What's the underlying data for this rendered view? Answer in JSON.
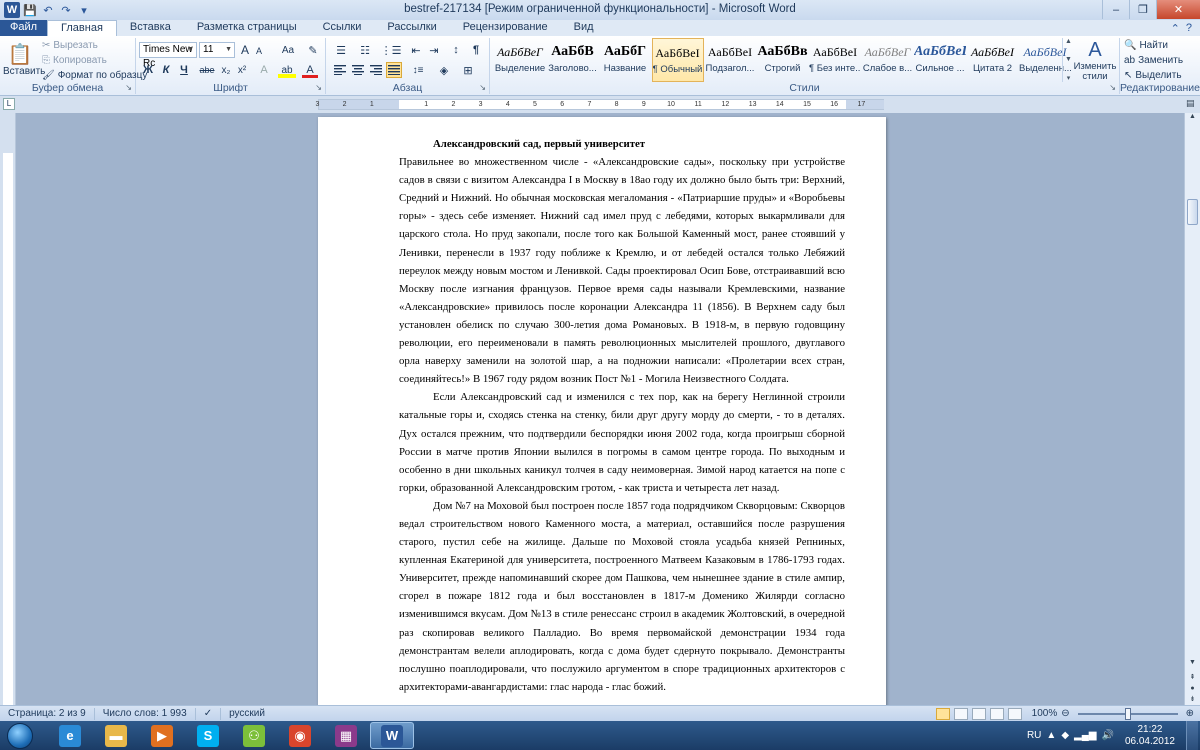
{
  "window": {
    "title": "bestref-217134 [Режим ограниченной функциональности]  -  Microsoft Word",
    "minimize": "–",
    "maximize": "❐",
    "close": "✕"
  },
  "quick_access": [
    "save-icon",
    "undo-icon",
    "redo-icon",
    "customize-icon"
  ],
  "tabs": [
    {
      "label": "Файл",
      "kind": "file"
    },
    {
      "label": "Главная",
      "kind": "active"
    },
    {
      "label": "Вставка"
    },
    {
      "label": "Разметка страницы"
    },
    {
      "label": "Ссылки"
    },
    {
      "label": "Рассылки"
    },
    {
      "label": "Рецензирование"
    },
    {
      "label": "Вид"
    }
  ],
  "ribbon": {
    "clipboard": {
      "group_label": "Буфер обмена",
      "paste": "Вставить",
      "cut": "Вырезать",
      "copy": "Копировать",
      "format_painter": "Формат по образцу"
    },
    "font": {
      "group_label": "Шрифт",
      "font_name": "Times New Rc",
      "font_size": "11",
      "grow": "A",
      "shrink": "A",
      "case": "Aa",
      "clear": "✎",
      "bold": "Ж",
      "italic": "К",
      "underline": "Ч",
      "strike": "abe",
      "subscript": "x₂",
      "superscript": "x²",
      "effects": "A",
      "highlight": "ab",
      "color": "A"
    },
    "paragraph": {
      "group_label": "Абзац",
      "bullets": "☰",
      "numbering": "☷",
      "multilevel": "⋮☰",
      "decrease_indent": "⇤",
      "increase_indent": "⇥",
      "sort": "↕",
      "show_marks": "¶"
    },
    "styles": {
      "group_label": "Стили",
      "items": [
        {
          "sample": "АаБбВеГ",
          "name": "Выделение",
          "italic": true,
          "bold": false,
          "color": "#000000"
        },
        {
          "sample": "АаБбВ",
          "name": "Заголово...",
          "italic": false,
          "bold": true,
          "color": "#000000"
        },
        {
          "sample": "АаБбГ",
          "name": "Название",
          "italic": false,
          "bold": true,
          "color": "#000000"
        },
        {
          "sample": "АаБбВеI",
          "name": "¶ Обычный",
          "italic": false,
          "bold": false,
          "color": "#000000",
          "selected": true
        },
        {
          "sample": "АаБбВеI",
          "name": "Подзагол...",
          "italic": false,
          "bold": false,
          "color": "#000000"
        },
        {
          "sample": "АаБбВв",
          "name": "Строгий",
          "italic": false,
          "bold": true,
          "color": "#000000"
        },
        {
          "sample": "АаБбВеI",
          "name": "¶ Без инте...",
          "italic": false,
          "bold": false,
          "color": "#000000"
        },
        {
          "sample": "АаБбВеГ",
          "name": "Слабое в...",
          "italic": true,
          "bold": false,
          "color": "#7f7f7f"
        },
        {
          "sample": "АаБбВеГ",
          "name": "Сильное ...",
          "italic": true,
          "bold": true,
          "color": "#2b579a"
        },
        {
          "sample": "АаБбВеI",
          "name": "Цитата 2",
          "italic": true,
          "bold": false,
          "color": "#000000"
        },
        {
          "sample": "АаБбВеI",
          "name": "Выделенн...",
          "italic": true,
          "bold": false,
          "color": "#2b579a"
        }
      ],
      "change_styles": "Изменить стили"
    },
    "editing": {
      "group_label": "Редактирование",
      "find": "Найти",
      "replace": "Заменить",
      "select": "Выделить"
    }
  },
  "document": {
    "title": "Александровский сад, первый университет",
    "paragraphs": [
      "Правильнее во множественном числе - «Александровские сады», поскольку при устройстве садов в связи с визитом Александра I в Москву в 18ао году их должно было быть три: Верхний, Средний и Нижний. Но обычная московская мегаломания - «Патриаршие пруды» и «Воробьевы горы» - здесь себе изменяет. Нижний сад имел пруд с лебедями, которых выкармливали для царского стола. Но пруд закопали, после того как Большой Каменный мост, ранее стоявший у Ленивки, перенесли в 1937 году поближе к Кремлю, и от лебедей остался только Лебяжий переулок между новым мостом и Ленивкой. Сады проектировал Осип Бове, отстраивавший всю Москву после изгнания французов. Первое время сады называли Кремлевскими, название «Александровские» привилось после коронации Александра 11 (1856). В Верхнем саду был установлен обелиск по случаю 300-летия дома Романовых. В 1918-м, в первую годовщину революции, его переименовали в память революционных мыслителей прошлого, двуглавого орла наверху заменили на золотой шар, а на подножии написали: «Пролетарии всех стран, соединяйтесь!» В 1967 году рядом возник Пост №1 - Могила Неизвестного Солдата.",
      "Если Александровский сад и изменился с тех пор, как на берегу Неглинной строили катальные горы и, сходясь стенка на стенку, били друг другу морду до смерти, - то в деталях. Дух остался прежним, что подтвердили беспорядки июня 2002 года, когда проигрыш сборной России в матче против Японии вылился в погромы в самом центре города. По выходным и особенно в дни школьных каникул толчея в саду неимоверная. Зимой народ катается на попе с горки, образованной Александровским гротом, - как триста и четыреста лет назад.",
      "Дом №7 на Моховой был построен после 1857 года подрядчиком Скворцовым: Скворцов ведал строительством нового Каменного моста, а материал, оставшийся после разрушения старого, пустил себе на жилище. Дальше по Моховой стояла усадьба князей Репниных, купленная Екатериной для университета, построенного Матвеем Казаковым в 1786-1793 годах. Университет, прежде напоминавший скорее дом Пашкова, чем нынешнее здание в стиле ампир, сгорел в пожаре 1812 года и был восстановлен в 1817-м Доменико Жилярди согласно изменившимся вкусам. Дом №13 в стиле ренессанс строил в академик Жолтовский, в очередной раз скопировав великого Палладио. Во время первомайской демонстрации 1934 года демонстрантам велели аплодировать, когда с дома будет сдернуто покрывало. Демонстранты послушно поаплодировали, что послужило аргументом в споре традиционных архитекторов с архитекторами-авангардистами: глас народа - глас божий."
    ]
  },
  "ruler": {
    "ticks": [
      "3",
      "2",
      "1",
      "1",
      "2",
      "3",
      "4",
      "5",
      "6",
      "7",
      "8",
      "9",
      "10",
      "11",
      "12",
      "13",
      "14",
      "15",
      "16",
      "17"
    ]
  },
  "statusbar": {
    "page": "Страница: 2 из 9",
    "words": "Число слов: 1 993",
    "language": "русский",
    "zoom": "100%",
    "zoom_level_percent": 100
  },
  "taskbar": {
    "apps": [
      {
        "icon": "internet-explorer-icon",
        "color": "#2a8ad6",
        "glyph": "e"
      },
      {
        "icon": "folder-icon",
        "color": "#e8b84a",
        "glyph": "▬"
      },
      {
        "icon": "media-player-icon",
        "color": "#e07020",
        "glyph": "▶"
      },
      {
        "icon": "skype-icon",
        "color": "#00aff0",
        "glyph": "S"
      },
      {
        "icon": "network-icon",
        "color": "#7cbf3a",
        "glyph": "⚇"
      },
      {
        "icon": "chrome-icon",
        "color": "#d9452c",
        "glyph": "◉"
      },
      {
        "icon": "winrar-icon",
        "color": "#8b3a8b",
        "glyph": "▦"
      },
      {
        "icon": "word-icon",
        "color": "#2b5797",
        "glyph": "W",
        "active": true
      }
    ],
    "lang": "RU",
    "time": "21:22",
    "date": "06.04.2012"
  },
  "colors": {
    "accent": "#2b5797",
    "ribbon_bg": "#e3ecf8",
    "workspace": "#a0b3cc"
  }
}
